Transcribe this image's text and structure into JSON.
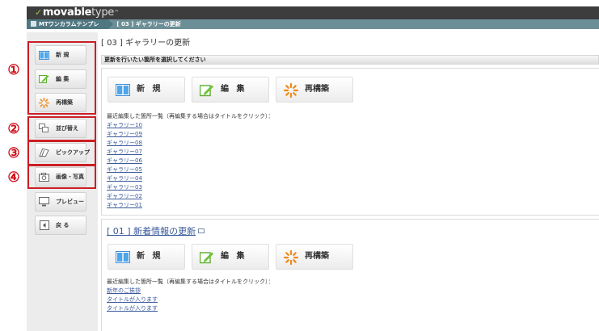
{
  "header": {
    "logo_bold": "movable",
    "logo_light": "type",
    "logo_tm": "™"
  },
  "breadcrumb": {
    "site": "MTワンカラムテンプレ",
    "current": "[ 03 ] ギャラリーの更新"
  },
  "sidebar": {
    "items": [
      {
        "label": "新 規",
        "icon": "columns-icon"
      },
      {
        "label": "編 集",
        "icon": "pencil-icon"
      },
      {
        "label": "再構築",
        "icon": "rebuild-icon"
      },
      {
        "label": "並び替え",
        "icon": "reorder-icon"
      },
      {
        "label": "ピックアップ",
        "icon": "pickup-icon"
      },
      {
        "label": "画像・写真",
        "icon": "camera-icon"
      },
      {
        "label": "プレビュー",
        "icon": "monitor-icon"
      },
      {
        "label": "戻 る",
        "icon": "back-icon"
      }
    ],
    "annotations": [
      "①",
      "②",
      "③",
      "④"
    ]
  },
  "main": {
    "page_title": "[ 03 ] ギャラリーの更新",
    "section_bar": "更新を行いたい箇所を選択してください",
    "buttons": {
      "new": "新 規",
      "edit": "編 集",
      "rebuild": "再構築"
    },
    "gallery": {
      "hint": "最近編集した箇所一覧（再編集する場合はタイトルをクリック）：",
      "links": [
        "ギャラリー10",
        "ギャラリー09",
        "ギャラリー08",
        "ギャラリー07",
        "ギャラリー06",
        "ギャラリー05",
        "ギャラリー04",
        "ギャラリー03",
        "ギャラリー02",
        "ギャラリー01"
      ]
    },
    "news": {
      "title": "[ 01 ] 新着情報の更新",
      "hint": "最近編集した箇所一覧（再編集する場合はタイトルをクリック）：",
      "links": [
        "新年のご挨拶",
        "タイトルが入ります",
        "タイトルが入ります"
      ]
    }
  },
  "colors": {
    "topbar": "#3d3d3d",
    "crumbbar": "#6c8f97",
    "annotation": "#cc1f25",
    "link": "#3a5a9c"
  }
}
